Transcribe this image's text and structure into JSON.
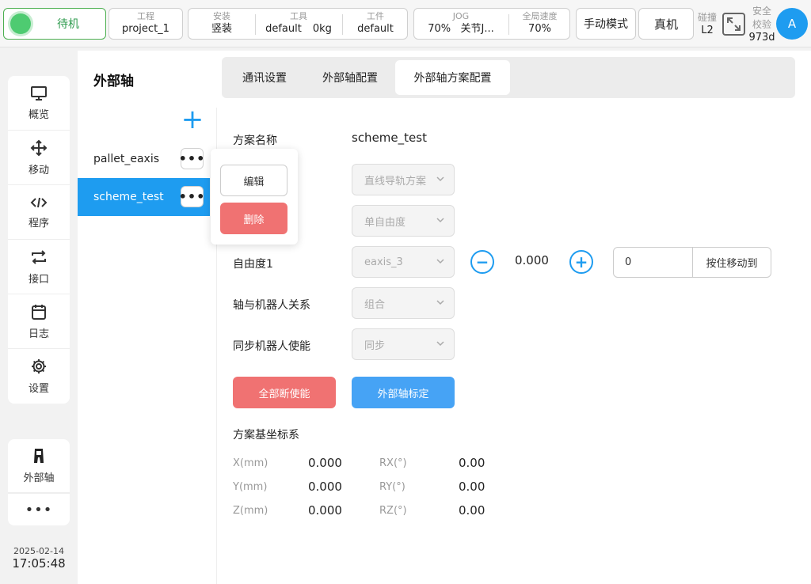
{
  "topbar": {
    "status": "待机",
    "project": {
      "label": "工程",
      "value": "project_1"
    },
    "install": {
      "label": "安装",
      "value": "竖装"
    },
    "tool": {
      "label": "工具",
      "value": "default",
      "payload": "0kg"
    },
    "workpiece": {
      "label": "工件",
      "value": "default"
    },
    "jog": {
      "label": "JOG",
      "speed": "70%",
      "mode": "关节J..."
    },
    "global_speed": {
      "label": "全局速度",
      "value": "70%"
    },
    "mode_button": "手动模式",
    "robot_button": "真机",
    "collision": {
      "label": "碰撞",
      "value": "L2"
    },
    "safety": {
      "label1": "安全",
      "label2": "校验",
      "value": "973d"
    },
    "avatar": "A"
  },
  "nav": {
    "items": [
      {
        "label": "概览",
        "icon": "monitor-icon"
      },
      {
        "label": "移动",
        "icon": "move-icon"
      },
      {
        "label": "程序",
        "icon": "code-icon"
      },
      {
        "label": "接口",
        "icon": "interface-icon"
      },
      {
        "label": "日志",
        "icon": "calendar-icon"
      },
      {
        "label": "设置",
        "icon": "gear-icon"
      }
    ],
    "active_plugin": {
      "label": "外部轴",
      "icon": "external-axis-icon"
    },
    "more": "•••"
  },
  "clock": {
    "date": "2025-02-14",
    "time": "17:05:48"
  },
  "page": {
    "title": "外部轴",
    "tabs": [
      "通讯设置",
      "外部轴配置",
      "外部轴方案配置"
    ],
    "active_tab": 2
  },
  "schemes": {
    "items": [
      "pallet_eaxis",
      "scheme_test"
    ],
    "selected": 1,
    "add_icon": "+",
    "menu": {
      "edit": "编辑",
      "delete": "删除"
    }
  },
  "form": {
    "scheme_name_label": "方案名称",
    "scheme_name": "scheme_test",
    "type_value": "直线导轨方案",
    "dof_value": "单自由度",
    "dof1_label": "自由度1",
    "dof1_axis": "eaxis_3",
    "dof1_pos": "0.000",
    "move_target": "0",
    "move_button": "按住移动到",
    "relation_label": "轴与机器人关系",
    "relation_value": "组合",
    "sync_label": "同步机器人使能",
    "sync_value": "同步",
    "disable_all_button": "全部断使能",
    "calibrate_button": "外部轴标定"
  },
  "base_frame": {
    "title": "方案基坐标系",
    "x_label": "X(mm)",
    "x": "0.000",
    "y_label": "Y(mm)",
    "y": "0.000",
    "z_label": "Z(mm)",
    "z": "0.000",
    "rx_label": "RX(°)",
    "rx": "0.00",
    "ry_label": "RY(°)",
    "ry": "0.00",
    "rz_label": "RZ(°)",
    "rz": "0.00"
  },
  "colors": {
    "accent": "#1e9cf0",
    "danger": "#f07272",
    "ok": "#4ecb71"
  }
}
